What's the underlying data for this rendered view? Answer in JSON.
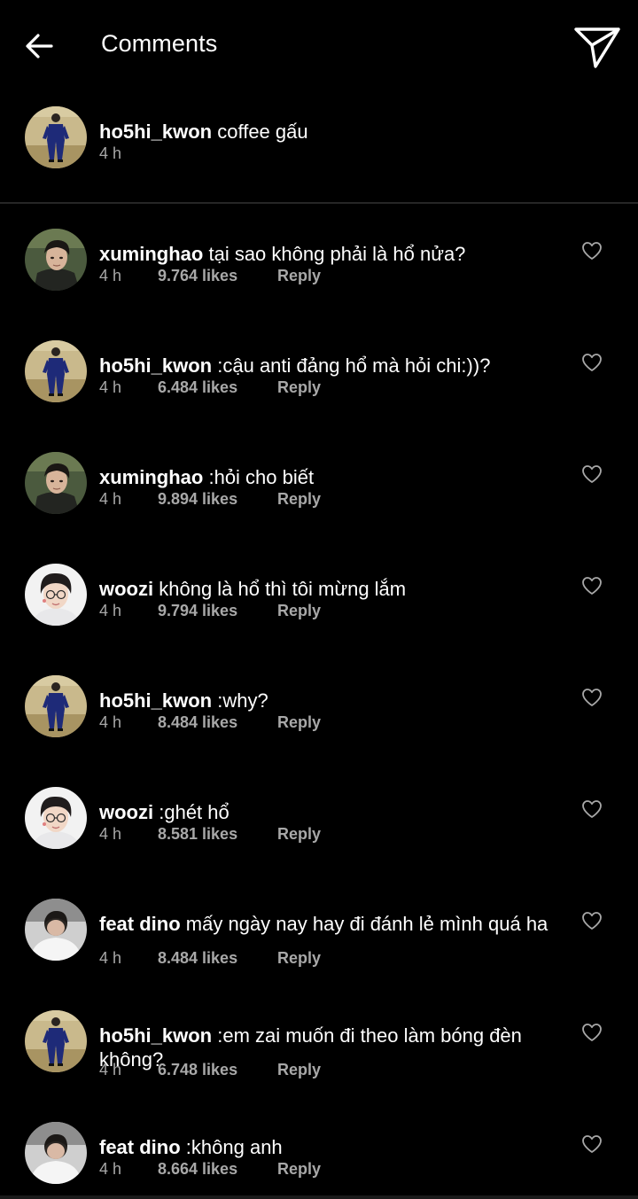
{
  "header": {
    "title": "Comments",
    "back_icon": "arrow-left-icon",
    "send_icon": "paper-plane-icon"
  },
  "caption": {
    "username": "ho5hi_kwon",
    "text": "coffee gấu",
    "time": "4 h",
    "avatar": "hoshi"
  },
  "comments": [
    {
      "username": "xuminghao",
      "text": "tại sao không phải là hổ nửa?",
      "time": "4 h",
      "likes": "9.764 likes",
      "reply": "Reply",
      "avatar": "minghao"
    },
    {
      "username": "ho5hi_kwon",
      "text": ":cậu anti đảng hổ mà hỏi chi:))?",
      "time": "4 h",
      "likes": "6.484 likes",
      "reply": "Reply",
      "avatar": "hoshi"
    },
    {
      "username": "xuminghao",
      "text": ":hỏi cho biết",
      "time": "4 h",
      "likes": "9.894 likes",
      "reply": "Reply",
      "avatar": "minghao"
    },
    {
      "username": "woozi",
      "text": "không là hổ thì tôi mừng lắm",
      "time": "4 h",
      "likes": "9.794 likes",
      "reply": "Reply",
      "avatar": "woozi"
    },
    {
      "username": "ho5hi_kwon",
      "text": ":why?",
      "time": "4 h",
      "likes": "8.484 likes",
      "reply": "Reply",
      "avatar": "hoshi"
    },
    {
      "username": "woozi",
      "text": ":ghét hổ",
      "time": "4 h",
      "likes": "8.581 likes",
      "reply": "Reply",
      "avatar": "woozi"
    },
    {
      "username": "feat dino",
      "text": "mấy ngày nay hay đi đánh lẻ mình quá ha",
      "time": "4 h",
      "likes": "8.484 likes",
      "reply": "Reply",
      "avatar": "dino"
    },
    {
      "username": "ho5hi_kwon",
      "text": ":em zai muốn đi theo làm bóng đèn không?",
      "time": "4 h",
      "likes": "6.748 likes",
      "reply": "Reply",
      "avatar": "hoshi"
    },
    {
      "username": "feat dino",
      "text": ":không anh",
      "time": "4 h",
      "likes": "8.664 likes",
      "reply": "Reply",
      "avatar": "dino"
    }
  ],
  "icons": {
    "like": "heart-outline-icon"
  },
  "colors": {
    "background": "#000000",
    "meta": "#a8a8a8",
    "divider": "#262626"
  }
}
